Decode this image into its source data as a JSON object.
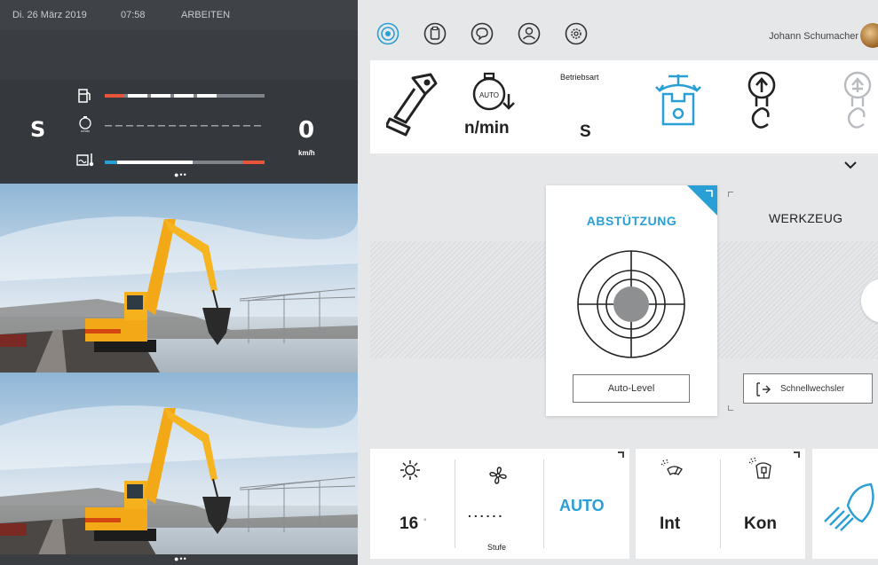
{
  "status_bar": {
    "date": "Di. 26 März 2019",
    "time": "07:58",
    "state": "ARBEITEN"
  },
  "gauges": {
    "mode": "S",
    "speed_value": "0",
    "speed_unit": "km/h",
    "rpm_unit_small": "n/min",
    "fuel_level": 0.78,
    "temp_level": 0.55,
    "pager": "●••"
  },
  "cameras": {
    "count": 2,
    "pager": "●••"
  },
  "topbar": {
    "icons": [
      "operating-mode-icon",
      "clipboard-icon",
      "chat-icon",
      "user-icon",
      "settings-icon"
    ],
    "user_name": "Johann Schumacher"
  },
  "toolstrip": {
    "betriebsart_label": "Betriebsart",
    "betriebsart_value": "S",
    "rpm_label": "n/min",
    "auto_badge": "AUTO"
  },
  "main": {
    "card_title": "ABSTÜTZUNG",
    "auto_level_button": "Auto-Level",
    "werkzeug_label": "WERKZEUG",
    "schnellwechsler_button": "Schnellwechsler"
  },
  "bottom": {
    "temperature_value": "16",
    "temperature_unit": "°",
    "fan_dots": "......",
    "fan_label": "Stufe",
    "auto_label": "AUTO",
    "wiper_front_value": "Int",
    "wiper_roof_value": "Kon"
  },
  "colors": {
    "accent": "#2a9fd6",
    "left_panel_bg": "#3a3d42",
    "fuel_low": "#e8553a",
    "temp_cold": "#2a9fd6"
  }
}
